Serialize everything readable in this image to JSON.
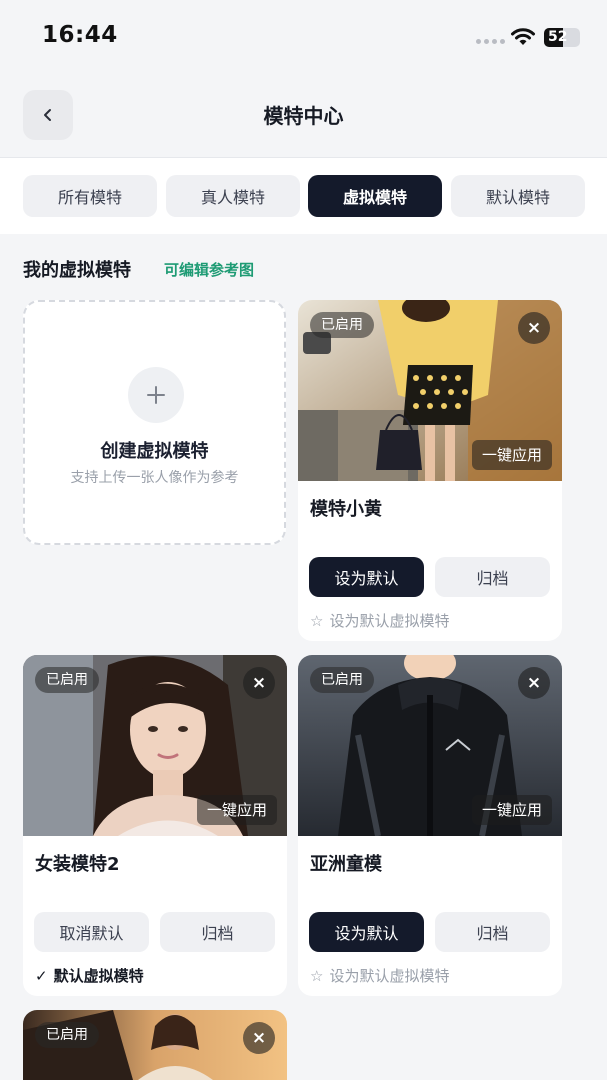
{
  "status_bar": {
    "time": "16:44",
    "battery": "52",
    "battery_level": 0.52,
    "icons": [
      "cellular-dots-icon",
      "wifi-icon",
      "battery-icon"
    ]
  },
  "header": {
    "title": "模特中心",
    "back_icon": "chevron-left-icon"
  },
  "tabs": [
    {
      "label": "所有模特",
      "active": false
    },
    {
      "label": "真人模特",
      "active": false
    },
    {
      "label": "虚拟模特",
      "active": true
    },
    {
      "label": "默认模特",
      "active": false
    }
  ],
  "section": {
    "title": "我的虚拟模特",
    "link": "可编辑参考图"
  },
  "create_card": {
    "icon": "plus-icon",
    "title": "创建虚拟模特",
    "subtitle": "支持上传一张人像作为参考"
  },
  "cards": [
    {
      "badge": "已启用",
      "apply_label": "一键应用",
      "name": "模特小黄",
      "primary_label": "设为默认",
      "archive_label": "归档",
      "hint": "设为默认虚拟模特",
      "is_default": false
    },
    {
      "badge": "已启用",
      "apply_label": "一键应用",
      "name": "女装模特2",
      "primary_label": "取消默认",
      "archive_label": "归档",
      "hint": "默认虚拟模特",
      "is_default": true
    },
    {
      "badge": "已启用",
      "apply_label": "一键应用",
      "name": "亚洲童模",
      "primary_label": "设为默认",
      "archive_label": "归档",
      "hint": "设为默认虚拟模特",
      "is_default": false
    },
    {
      "badge": "已启用"
    }
  ],
  "colors": {
    "accent_dark": "#141a2b",
    "link_green": "#1e9b74",
    "background": "#f4f5f7",
    "muted_text": "#9aa0aa"
  }
}
